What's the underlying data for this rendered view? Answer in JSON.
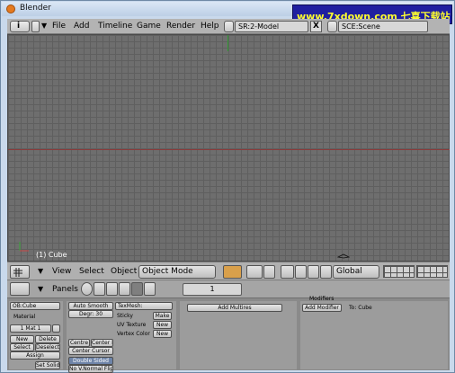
{
  "window": {
    "title": "Blender"
  },
  "watermark": "www.7xdown.com 七喜下载站",
  "topbar": {
    "menus": [
      "File",
      "Add",
      "Timeline",
      "Game",
      "Render",
      "Help"
    ],
    "screen_field": "SR:2-Model",
    "scene_field": "SCE:Scene",
    "close_glyph": "X"
  },
  "viewport": {
    "object_label": "(1) Cube"
  },
  "header3d": {
    "view_menu": "View",
    "select_menu": "Select",
    "object_menu": "Object",
    "mode": "Object Mode",
    "orientation": "Global"
  },
  "buttons_header": {
    "panels_label": "Panels",
    "frame_value": "1"
  },
  "link_panel": {
    "object_field": "OB:Cube",
    "material_label": "Material",
    "mat_index": "1 Mat 1",
    "new": "New",
    "delete": "Delete",
    "select": "Select",
    "deselect": "Deselect",
    "assign": "Assign",
    "set_solid": "Set Solid"
  },
  "mesh_panel": {
    "auto_smooth": "Auto Smooth",
    "degr": "Degr: 30",
    "centre": "Centre",
    "center_new": "Center New",
    "center_cursor": "Center Cursor",
    "double_sided": "Double Sided",
    "no_v_normal_flip": "No V.Normal Flip"
  },
  "texmesh_panel": {
    "texmesh_field": "TexMesh:",
    "sticky": "Sticky",
    "uv_texture": "UV Texture",
    "vertex_color": "Vertex Color",
    "make": "Make",
    "new1": "New",
    "new2": "New"
  },
  "multires_panel": {
    "add_multires": "Add Multires"
  },
  "modifiers_panel": {
    "tab_label": "Modifiers",
    "add_modifier": "Add Modifier",
    "to_label": "To: Cube"
  }
}
